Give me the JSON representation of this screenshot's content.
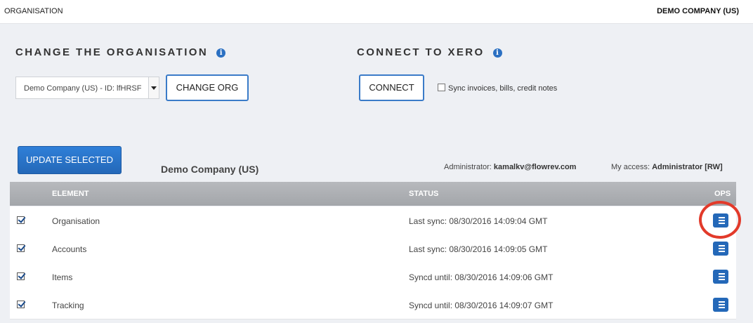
{
  "topbar": {
    "left_label": "ORGANISATION",
    "company": "DEMO COMPANY (US)"
  },
  "change_org": {
    "heading": "CHANGE THE ORGANISATION",
    "select_value": "Demo Company (US) - ID: lfHRSF",
    "button": "CHANGE ORG"
  },
  "xero": {
    "heading": "CONNECT TO XERO",
    "button": "CONNECT",
    "sync_label": "Sync invoices, bills, credit notes"
  },
  "toolbar": {
    "update_button": "UPDATE SELECTED",
    "company_name": "Demo Company (US)",
    "admin_label": "Administrator:",
    "admin_value": "kamalkv@flowrev.com",
    "access_label": "My access:",
    "access_value": "Administrator [RW]"
  },
  "table": {
    "columns": [
      "ELEMENT",
      "STATUS",
      "OPS"
    ],
    "rows": [
      {
        "element": "Organisation",
        "status": "Last sync: 08/30/2016 14:09:04 GMT",
        "checked": true
      },
      {
        "element": "Accounts",
        "status": "Last sync: 08/30/2016 14:09:05 GMT",
        "checked": true
      },
      {
        "element": "Items",
        "status": "Syncd until: 08/30/2016 14:09:06 GMT",
        "checked": true
      },
      {
        "element": "Tracking",
        "status": "Syncd until: 08/30/2016 14:09:07 GMT",
        "checked": true
      }
    ]
  },
  "icons": {
    "info": "info-icon",
    "ops": "list-icon"
  },
  "colors": {
    "accent": "#2468b8",
    "highlight": "#e23a2a",
    "table_header": "#a3a6aa"
  }
}
